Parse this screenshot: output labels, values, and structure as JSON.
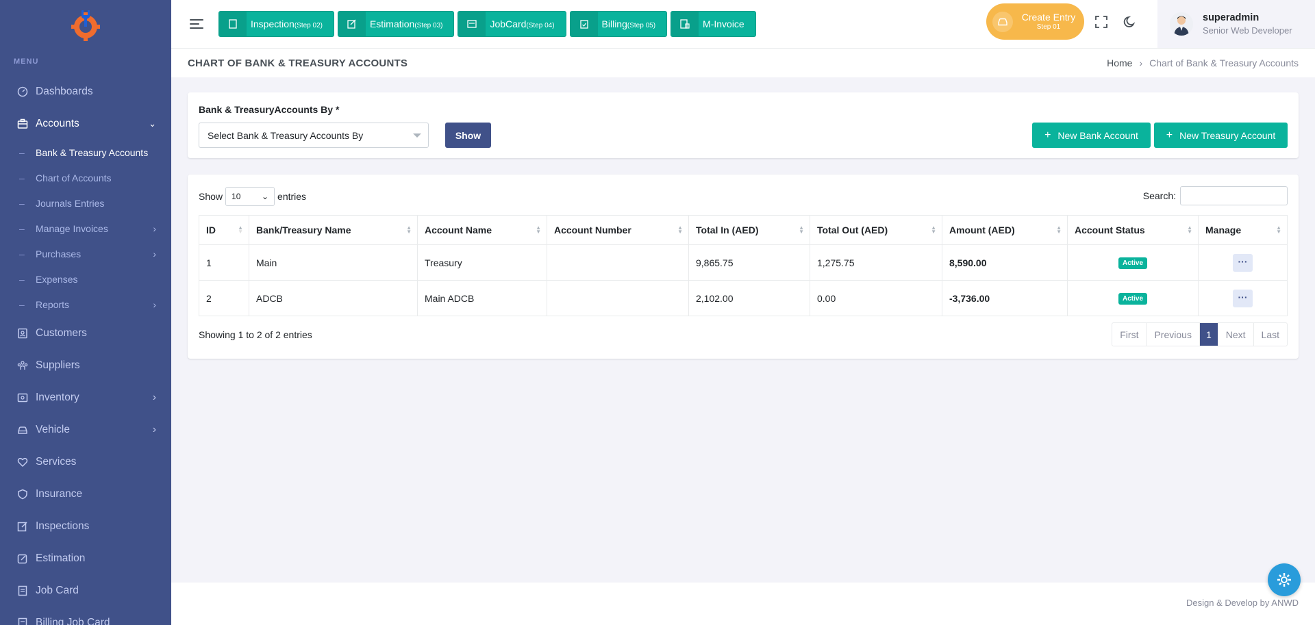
{
  "app": {
    "title": "Chart of Bank & Treasury Accounts"
  },
  "colors": {
    "sidebar": "#405189",
    "accent_green": "#0ab39c",
    "accent_yellow": "#f7b84b",
    "primary": "#405189"
  },
  "sidebar": {
    "menu_title": "MENU",
    "items": [
      {
        "label": "Dashboards",
        "icon": "dashboard-icon"
      },
      {
        "label": "Accounts",
        "icon": "briefcase-icon",
        "expanded": true
      },
      {
        "label": "Customers",
        "icon": "contacts-icon"
      },
      {
        "label": "Suppliers",
        "icon": "group-icon"
      },
      {
        "label": "Inventory",
        "icon": "inventory-icon"
      },
      {
        "label": "Vehicle",
        "icon": "car-icon"
      },
      {
        "label": "Services",
        "icon": "heart-icon"
      },
      {
        "label": "Insurance",
        "icon": "shield-icon"
      },
      {
        "label": "Inspections",
        "icon": "edit-box-icon"
      },
      {
        "label": "Estimation",
        "icon": "edit-icon"
      },
      {
        "label": "Job Card",
        "icon": "file-icon"
      },
      {
        "label": "Billing Job Card",
        "icon": "file-icon"
      }
    ],
    "accounts_sub": [
      {
        "label": "Bank & Treasury Accounts"
      },
      {
        "label": "Chart of Accounts"
      },
      {
        "label": "Journals Entries"
      },
      {
        "label": "Manage Invoices"
      },
      {
        "label": "Purchases"
      },
      {
        "label": "Expenses"
      },
      {
        "label": "Reports"
      }
    ]
  },
  "topbar": {
    "steps": [
      {
        "label": "Inspection",
        "step": "(Step 02)"
      },
      {
        "label": "Estimation",
        "step": "(Step 03)"
      },
      {
        "label": "JobCard",
        "step": "(Step 04)"
      },
      {
        "label": "Billing",
        "step": "(Step 05)"
      },
      {
        "label": "M-Invoice",
        "step": ""
      }
    ],
    "create_entry": {
      "label": "Create Entry",
      "step": "Step 01"
    },
    "user": {
      "name": "superadmin",
      "role": "Senior Web Developer"
    }
  },
  "page": {
    "title": "CHART OF BANK & TREASURY ACCOUNTS",
    "breadcrumb_home": "Home",
    "breadcrumb_sep": "›",
    "breadcrumb_current": "Chart of Bank & Treasury Accounts"
  },
  "filter": {
    "label": "Bank & TreasuryAccounts By *",
    "select_value": "Select Bank & Treasury Accounts By",
    "show_label": "Show",
    "new_bank_label": "New Bank Account",
    "new_treasury_label": "New Treasury Account"
  },
  "table": {
    "show_label": "Show",
    "entries_value": "10",
    "entries_label": "entries",
    "search_label": "Search:",
    "columns": [
      "ID",
      "Bank/Treasury Name",
      "Account Name",
      "Account Number",
      "Total In (AED)",
      "Total Out (AED)",
      "Amount (AED)",
      "Account Status",
      "Manage"
    ],
    "rows": [
      {
        "id": "1",
        "bank": "Main",
        "account": "Treasury",
        "number": "",
        "total_in": "9,865.75",
        "total_out": "1,275.75",
        "amount": "8,590.00",
        "status": "Active",
        "manage": "···"
      },
      {
        "id": "2",
        "bank": "ADCB",
        "account": "Main ADCB",
        "number": "",
        "total_in": "2,102.00",
        "total_out": "0.00",
        "amount": "-3,736.00",
        "status": "Active",
        "manage": "···"
      }
    ],
    "info": "Showing 1 to 2 of 2 entries",
    "pager": {
      "first": "First",
      "previous": "Previous",
      "current": "1",
      "next": "Next",
      "last": "Last"
    }
  },
  "footer": {
    "text": "Design & Develop by ANWD"
  }
}
